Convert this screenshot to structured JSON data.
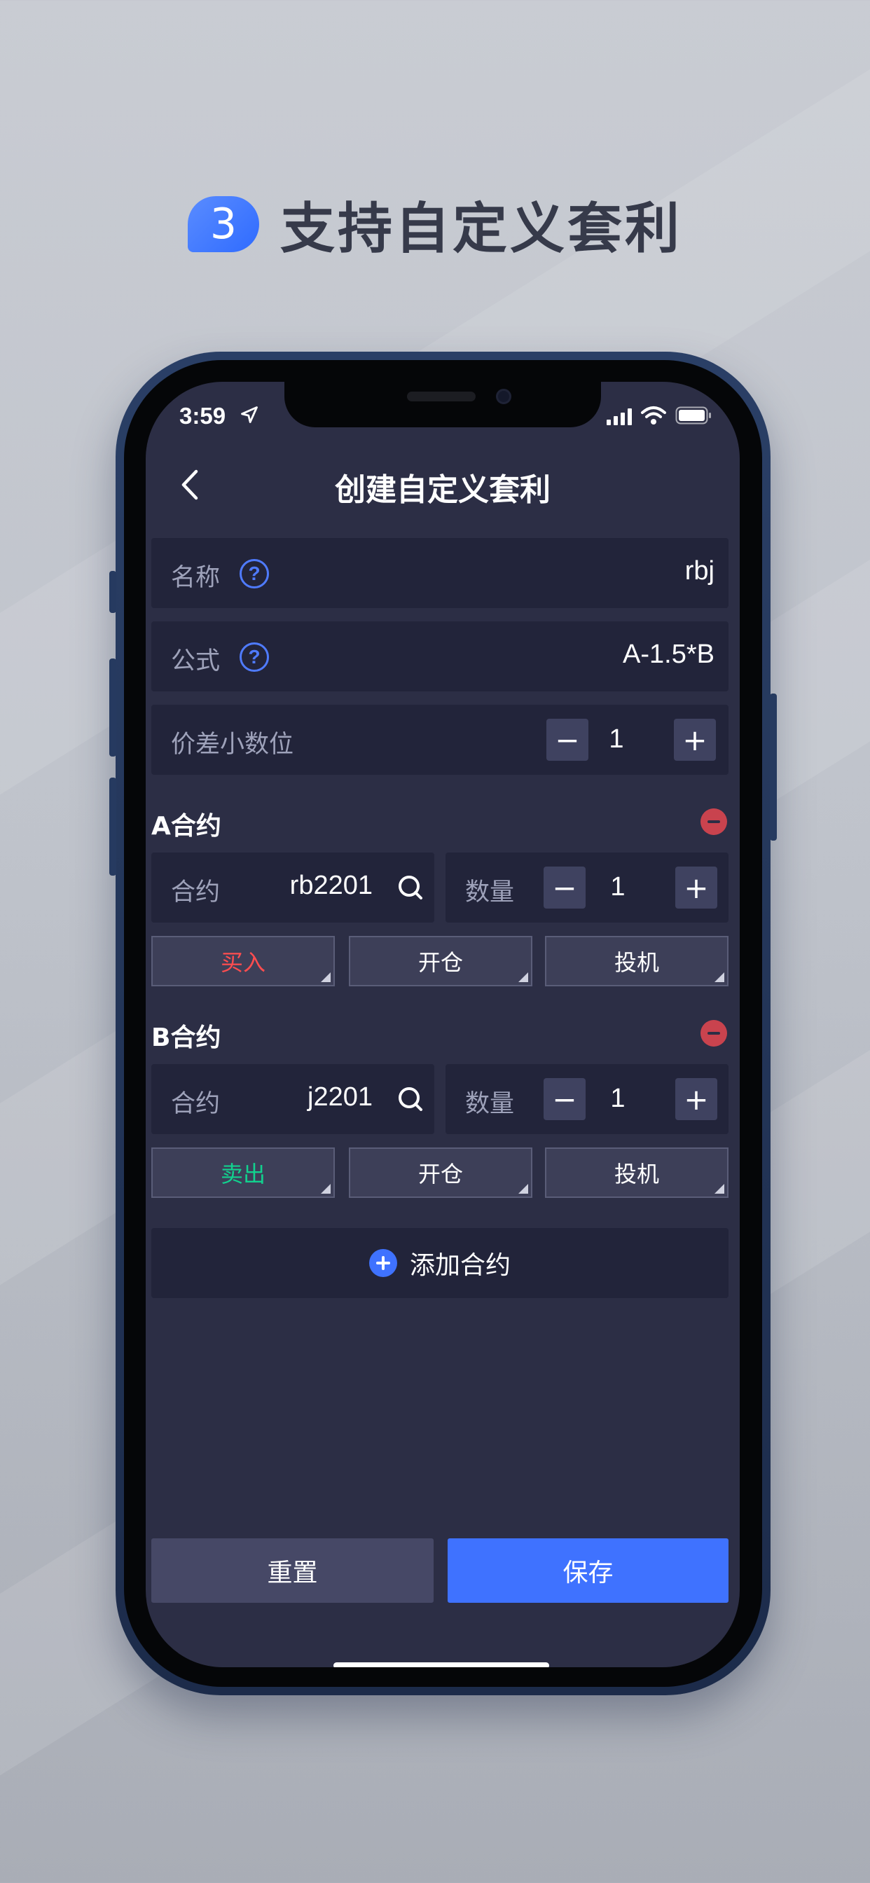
{
  "headline": {
    "step": "3",
    "text": "支持自定义套利"
  },
  "status_bar": {
    "time": "3:59"
  },
  "nav": {
    "title": "创建自定义套利"
  },
  "form": {
    "name": {
      "label": "名称",
      "value": "rbj"
    },
    "formula": {
      "label": "公式",
      "value": "A-1.5*B"
    },
    "decimals": {
      "label": "价差小数位",
      "value": "1",
      "minus": "−",
      "plus": "+"
    }
  },
  "contracts": [
    {
      "title": "A合约",
      "contract_label": "合约",
      "contract_value": "rb2201",
      "qty_label": "数量",
      "qty_value": "1",
      "minus": "−",
      "plus": "+",
      "direction": "买入",
      "offset": "开仓",
      "hedge": "投机"
    },
    {
      "title": "B合约",
      "contract_label": "合约",
      "contract_value": "j2201",
      "qty_label": "数量",
      "qty_value": "1",
      "minus": "−",
      "plus": "+",
      "direction": "卖出",
      "offset": "开仓",
      "hedge": "投机"
    }
  ],
  "add_contract": {
    "label": "添加合约"
  },
  "actions": {
    "reset": "重置",
    "save": "保存"
  },
  "colors": {
    "accent": "#3f72ff",
    "buy": "#ff4d4f",
    "sell": "#12d18e",
    "danger": "#c9434e",
    "screen_bg": "#2c2e45"
  }
}
